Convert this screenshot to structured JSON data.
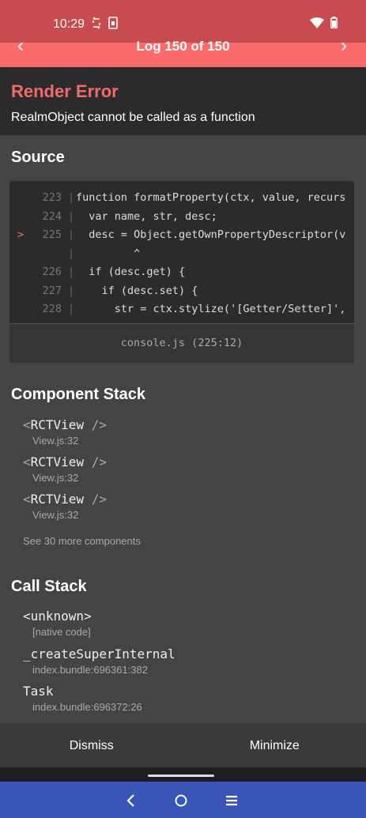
{
  "status_bar": {
    "time": "10:29"
  },
  "header": {
    "title": "Log 150 of 150",
    "prev_label": "‹",
    "next_label": "›"
  },
  "error": {
    "title": "Render Error",
    "message": "RealmObject cannot be called as a function"
  },
  "source": {
    "heading": "Source",
    "lines": [
      {
        "marker": "",
        "num": "223",
        "sep": "|",
        "text": "function formatProperty(ctx, value, recurs"
      },
      {
        "marker": "",
        "num": "224",
        "sep": "|",
        "text": "  var name, str, desc;"
      },
      {
        "marker": ">",
        "num": "225",
        "sep": "|",
        "text": "  desc = Object.getOwnPropertyDescriptor(v"
      },
      {
        "marker": "",
        "num": "",
        "sep": "|",
        "text": "         ^"
      },
      {
        "marker": "",
        "num": "226",
        "sep": "|",
        "text": "  if (desc.get) {"
      },
      {
        "marker": "",
        "num": "227",
        "sep": "|",
        "text": "    if (desc.set) {"
      },
      {
        "marker": "",
        "num": "228",
        "sep": "|",
        "text": "      str = ctx.stylize('[Getter/Setter]',"
      }
    ],
    "file": "console.js (225:12)"
  },
  "component_stack": {
    "heading": "Component Stack",
    "items": [
      {
        "open": "<",
        "name": "RCTView",
        "close": " />",
        "location": "View.js:32"
      },
      {
        "open": "<",
        "name": "RCTView",
        "close": " />",
        "location": "View.js:32"
      },
      {
        "open": "<",
        "name": "RCTView",
        "close": " />",
        "location": "View.js:32"
      }
    ],
    "more": "See 30 more components"
  },
  "call_stack": {
    "heading": "Call Stack",
    "items": [
      {
        "name": "<unknown>",
        "location": "[native code]"
      },
      {
        "name": "_createSuperInternal",
        "location": "index.bundle:696361:382"
      },
      {
        "name": "Task",
        "location": "index.bundle:696372:26"
      }
    ]
  },
  "footer": {
    "dismiss": "Dismiss",
    "minimize": "Minimize"
  },
  "colors": {
    "accent": "#fa6b6b",
    "status_bar": "#c84b50",
    "nav_bar": "#3a55b8"
  }
}
